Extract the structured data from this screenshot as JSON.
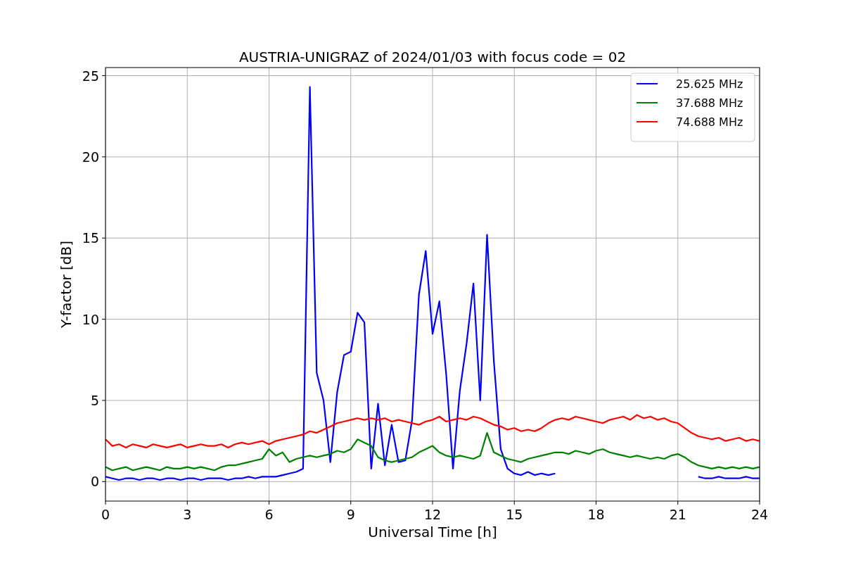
{
  "chart_data": {
    "type": "line",
    "title": "AUSTRIA-UNIGRAZ of 2024/01/03 with focus code = 02",
    "xlabel": "Universal Time [h]",
    "ylabel": "Y-factor [dB]",
    "x": [
      0,
      0.25,
      0.5,
      0.75,
      1,
      1.25,
      1.5,
      1.75,
      2,
      2.25,
      2.5,
      2.75,
      3,
      3.25,
      3.5,
      3.75,
      4,
      4.25,
      4.5,
      4.75,
      5,
      5.25,
      5.5,
      5.75,
      6,
      6.25,
      6.5,
      6.75,
      7,
      7.25,
      7.5,
      7.75,
      8,
      8.25,
      8.5,
      8.75,
      9,
      9.25,
      9.5,
      9.75,
      10,
      10.25,
      10.5,
      10.75,
      11,
      11.25,
      11.5,
      11.75,
      12,
      12.25,
      12.5,
      12.75,
      13,
      13.25,
      13.5,
      13.75,
      14,
      14.25,
      14.5,
      14.75,
      15,
      15.25,
      15.5,
      15.75,
      16,
      16.25,
      16.5,
      16.75,
      17,
      17.25,
      17.5,
      17.75,
      18,
      18.25,
      18.5,
      18.75,
      19,
      19.25,
      19.5,
      19.75,
      20,
      20.25,
      20.5,
      20.75,
      21,
      21.25,
      21.5,
      21.75,
      22,
      22.25,
      22.5,
      22.75,
      23,
      23.25,
      23.5,
      23.75,
      24
    ],
    "series": [
      {
        "name": "25.625 MHz",
        "color": "#0000ff",
        "values": [
          0.3,
          0.2,
          0.1,
          0.2,
          0.2,
          0.1,
          0.2,
          0.2,
          0.1,
          0.2,
          0.2,
          0.1,
          0.2,
          0.2,
          0.1,
          0.2,
          0.2,
          0.2,
          0.1,
          0.2,
          0.2,
          0.3,
          0.2,
          0.3,
          0.3,
          0.3,
          0.4,
          0.5,
          0.6,
          0.8,
          24.3,
          6.7,
          5.0,
          1.2,
          5.5,
          7.8,
          8.0,
          10.4,
          9.8,
          0.8,
          4.8,
          1.0,
          3.5,
          1.2,
          1.3,
          3.8,
          11.5,
          14.2,
          9.1,
          11.1,
          6.6,
          0.8,
          5.6,
          8.5,
          12.2,
          5.0,
          15.2,
          7.4,
          2.0,
          0.8,
          0.5,
          0.4,
          0.6,
          0.4,
          0.5,
          0.4,
          0.5,
          null,
          null,
          null,
          null,
          null,
          null,
          null,
          null,
          null,
          null,
          null,
          null,
          null,
          null,
          null,
          null,
          null,
          null,
          null,
          null,
          0.3,
          0.2,
          0.2,
          0.3,
          0.2,
          0.2,
          0.2,
          0.3,
          0.2,
          0.2
        ]
      },
      {
        "name": "37.688 MHz",
        "color": "#008000",
        "values": [
          0.9,
          0.7,
          0.8,
          0.9,
          0.7,
          0.8,
          0.9,
          0.8,
          0.7,
          0.9,
          0.8,
          0.8,
          0.9,
          0.8,
          0.9,
          0.8,
          0.7,
          0.9,
          1.0,
          1.0,
          1.1,
          1.2,
          1.3,
          1.4,
          2.0,
          1.6,
          1.8,
          1.2,
          1.4,
          1.5,
          1.6,
          1.5,
          1.6,
          1.7,
          1.9,
          1.8,
          2.0,
          2.6,
          2.4,
          2.2,
          1.5,
          1.3,
          1.2,
          1.3,
          1.4,
          1.5,
          1.8,
          2.0,
          2.2,
          1.8,
          1.6,
          1.5,
          1.6,
          1.5,
          1.4,
          1.6,
          3.0,
          1.8,
          1.6,
          1.4,
          1.3,
          1.2,
          1.4,
          1.5,
          1.6,
          1.7,
          1.8,
          1.8,
          1.7,
          1.9,
          1.8,
          1.7,
          1.9,
          2.0,
          1.8,
          1.7,
          1.6,
          1.5,
          1.6,
          1.5,
          1.4,
          1.5,
          1.4,
          1.6,
          1.7,
          1.5,
          1.2,
          1.0,
          0.9,
          0.8,
          0.9,
          0.8,
          0.9,
          0.8,
          0.9,
          0.8,
          0.9
        ]
      },
      {
        "name": "74.688 MHz",
        "color": "#ff0000",
        "values": [
          2.6,
          2.2,
          2.3,
          2.1,
          2.3,
          2.2,
          2.1,
          2.3,
          2.2,
          2.1,
          2.2,
          2.3,
          2.1,
          2.2,
          2.3,
          2.2,
          2.2,
          2.3,
          2.1,
          2.3,
          2.4,
          2.3,
          2.4,
          2.5,
          2.3,
          2.5,
          2.6,
          2.7,
          2.8,
          2.9,
          3.1,
          3.0,
          3.2,
          3.4,
          3.6,
          3.7,
          3.8,
          3.9,
          3.8,
          3.9,
          3.8,
          3.9,
          3.7,
          3.8,
          3.7,
          3.6,
          3.5,
          3.7,
          3.8,
          4.0,
          3.7,
          3.8,
          3.9,
          3.8,
          4.0,
          3.9,
          3.7,
          3.5,
          3.4,
          3.2,
          3.3,
          3.1,
          3.2,
          3.1,
          3.3,
          3.6,
          3.8,
          3.9,
          3.8,
          4.0,
          3.9,
          3.8,
          3.7,
          3.6,
          3.8,
          3.9,
          4.0,
          3.8,
          4.1,
          3.9,
          4.0,
          3.8,
          3.9,
          3.7,
          3.6,
          3.3,
          3.0,
          2.8,
          2.7,
          2.6,
          2.7,
          2.5,
          2.6,
          2.7,
          2.5,
          2.6,
          2.5
        ]
      }
    ],
    "xlim": [
      0,
      24
    ],
    "ylim": [
      -1.2,
      25.5
    ],
    "xticks": [
      0,
      3,
      6,
      9,
      12,
      15,
      18,
      21,
      24
    ],
    "yticks": [
      0,
      5,
      10,
      15,
      20,
      25
    ],
    "grid": true,
    "legend": true
  }
}
